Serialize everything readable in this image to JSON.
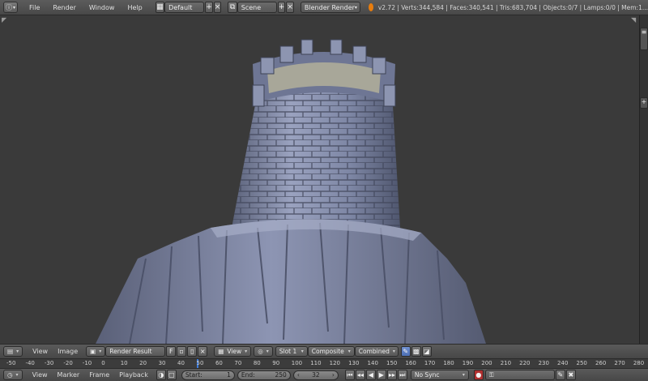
{
  "top": {
    "editor_icon": "info-icon",
    "menus": [
      "File",
      "Render",
      "Window",
      "Help"
    ],
    "screen_layout": "Default",
    "scene": "Scene",
    "engine": "Blender Render",
    "stats": "v2.72 | Verts:344,584 | Faces:340,541 | Tris:683,704 | Objects:0/7 | Lamps:0/0 | Mem:1..."
  },
  "image_editor": {
    "menus": [
      "View",
      "Image"
    ],
    "image_name": "Render Result",
    "fake_user": "F",
    "view": "View",
    "slot": "Slot 1",
    "layer": "Composite",
    "pass": "Combined"
  },
  "ruler": {
    "ticks": [
      "-50",
      "-40",
      "-30",
      "-20",
      "-10",
      "0",
      "10",
      "20",
      "30",
      "40",
      "50",
      "60",
      "70",
      "80",
      "90",
      "100",
      "110",
      "120",
      "130",
      "140",
      "150",
      "160",
      "170",
      "180",
      "190",
      "200",
      "210",
      "220",
      "230",
      "240",
      "250",
      "260",
      "270",
      "280"
    ]
  },
  "timeline": {
    "menus": [
      "View",
      "Marker",
      "Frame",
      "Playback"
    ],
    "start_label": "Start:",
    "start_value": "1",
    "end_label": "End:",
    "end_value": "250",
    "current_frame": "32",
    "sync": "No Sync"
  },
  "colors": {
    "tower": "#7f88a6",
    "viewport_bg": "#3a3a3a",
    "accent_blue": "#3c7bdc",
    "logo_orange": "#e87d0d"
  }
}
